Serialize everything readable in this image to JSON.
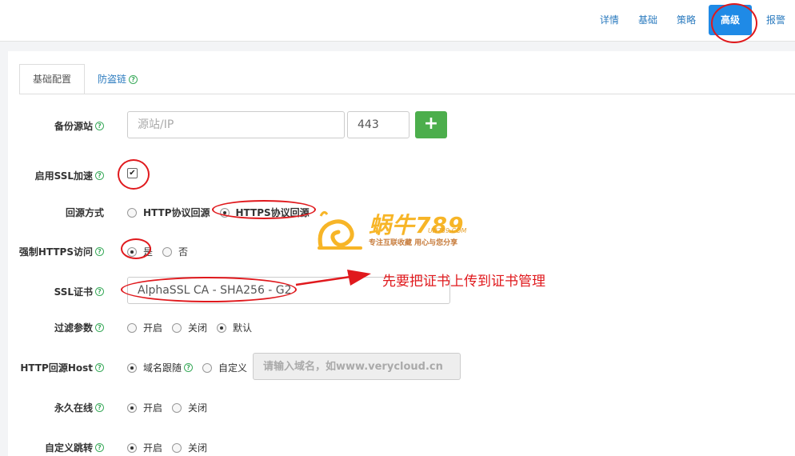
{
  "top_nav": [
    "详情",
    "基础",
    "策略",
    "高级",
    "报警"
  ],
  "tabs": {
    "basic": "基础配置",
    "hotlink": "防盗链"
  },
  "form": {
    "backup_origin": {
      "label": "备份源站",
      "placeholder": "源站/IP",
      "port_value": "443",
      "add_label": "+"
    },
    "ssl_accel": {
      "label": "启用SSL加速",
      "checked": true
    },
    "origin_mode": {
      "label": "回源方式",
      "options": [
        "HTTP协议回源",
        "HTTPS协议回源"
      ],
      "selected": "HTTPS协议回源"
    },
    "force_https": {
      "label": "强制HTTPS访问",
      "options": [
        "是",
        "否"
      ],
      "selected": "是"
    },
    "ssl_cert": {
      "label": "SSL证书",
      "value": "AlphaSSL CA - SHA256 - G2"
    },
    "filter_params": {
      "label": "过滤参数",
      "options": [
        "开启",
        "关闭",
        "默认"
      ],
      "selected": "默认"
    },
    "http_host": {
      "label": "HTTP回源Host",
      "options": [
        "域名跟随",
        "自定义"
      ],
      "selected": "域名跟随",
      "placeholder": "请输入域名，如www.verycloud.cn"
    },
    "always_online": {
      "label": "永久在线",
      "options": [
        "开启",
        "关闭"
      ],
      "selected": "开启"
    },
    "custom_redirect": {
      "label": "自定义跳转",
      "options": [
        "开启",
        "关闭"
      ],
      "selected": "开启"
    }
  },
  "annotation": "先要把证书上传到证书管理",
  "watermark": {
    "title": "蜗牛789",
    "url": "UN789.COM",
    "slogan": "专注互联收藏   用心与您分享"
  },
  "colors": {
    "accent": "#1f8ae6",
    "link": "#2b7bbf",
    "success": "#4cae4c",
    "annotation": "#e0191d",
    "help": "#3aaa5b"
  }
}
